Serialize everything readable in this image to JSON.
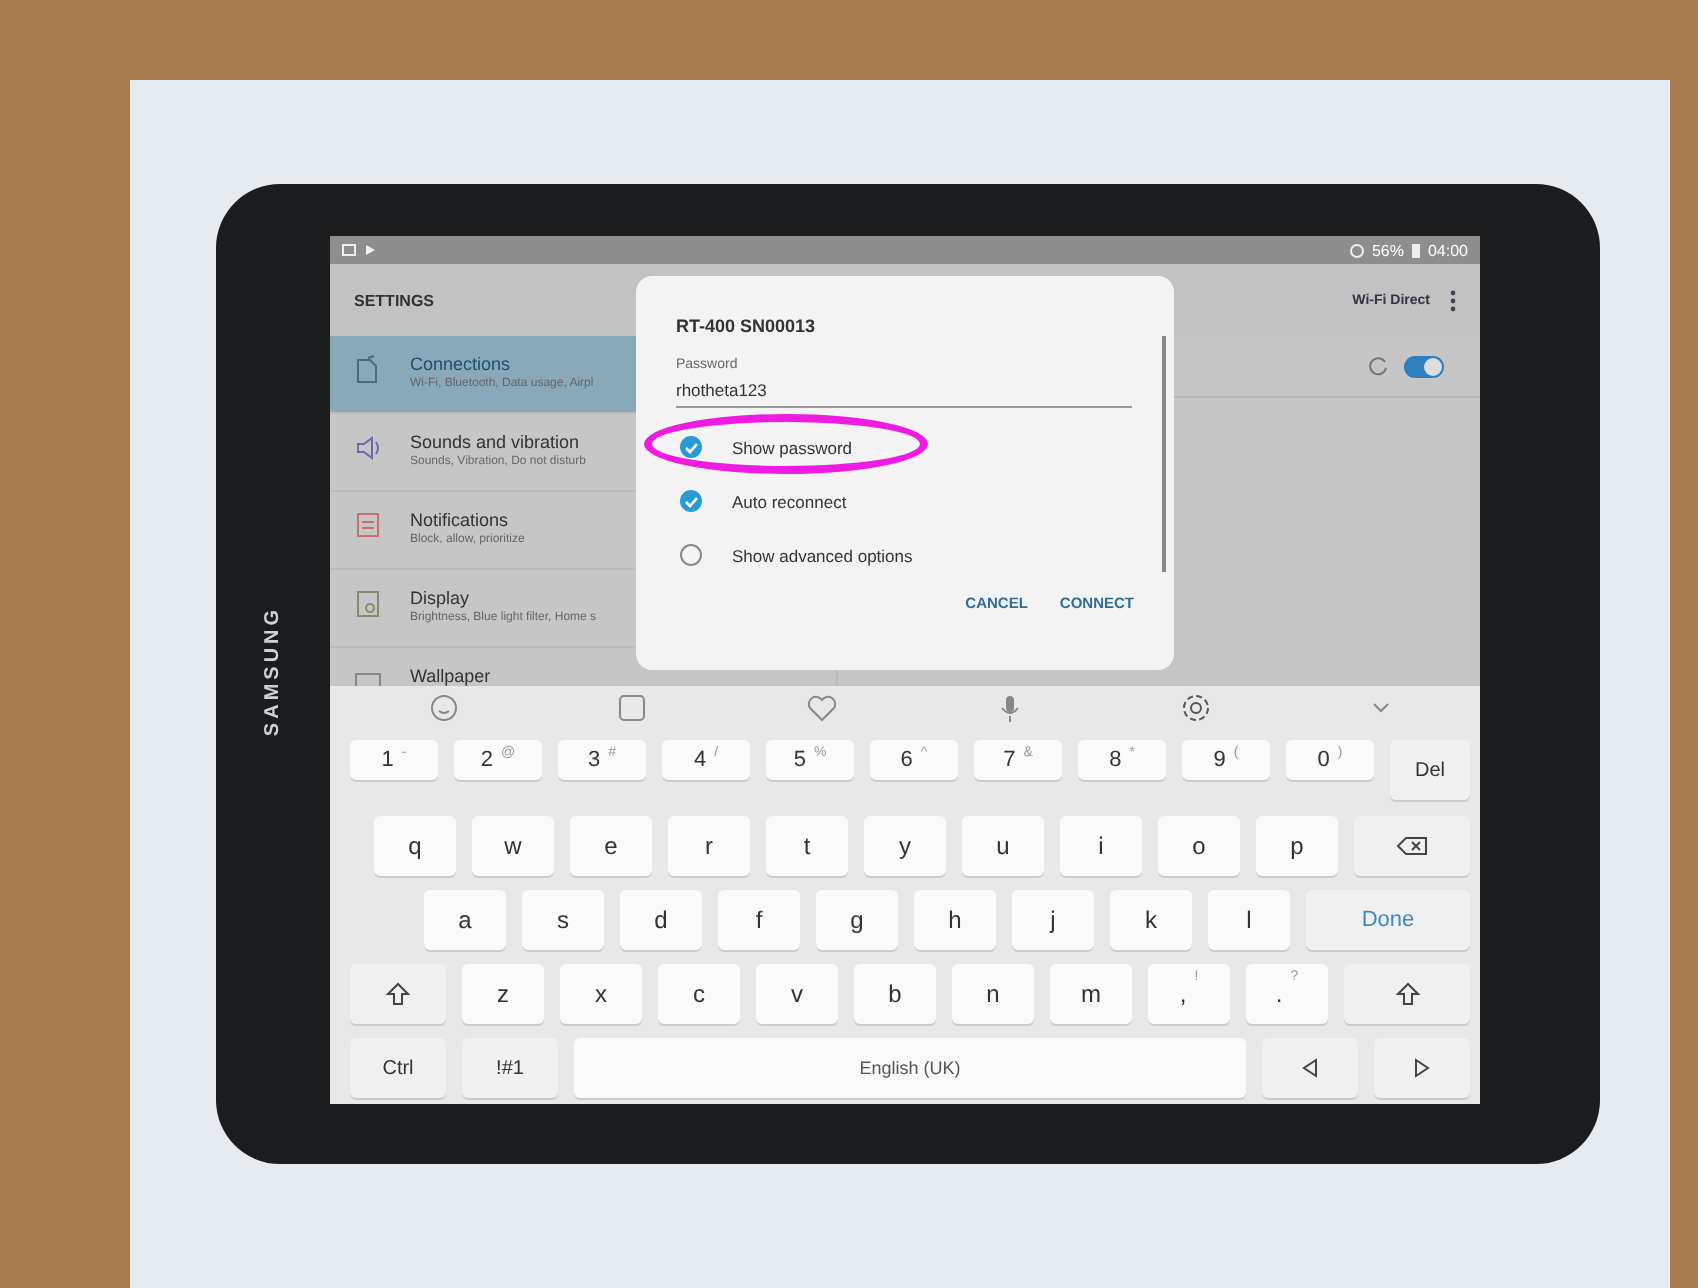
{
  "device": {
    "brand": "SAMSUNG"
  },
  "status_bar": {
    "battery": "56%",
    "time": "04:00"
  },
  "settings": {
    "title": "SETTINGS",
    "action": "Wi-Fi Direct",
    "switch": {
      "on": true
    },
    "items": [
      {
        "title": "Connections",
        "subtitle": "Wi-Fi, Bluetooth, Data usage, Airpl",
        "selected": true
      },
      {
        "title": "Sounds and vibration",
        "subtitle": "Sounds, Vibration, Do not disturb",
        "selected": false
      },
      {
        "title": "Notifications",
        "subtitle": "Block, allow, prioritize",
        "selected": false
      },
      {
        "title": "Display",
        "subtitle": "Brightness, Blue light filter, Home s",
        "selected": false
      },
      {
        "title": "Wallpaper",
        "selected": false
      }
    ]
  },
  "dialog": {
    "title": "RT-400 SN00013",
    "field_label": "Password",
    "password": "rhotheta123",
    "options": [
      {
        "label": "Show password",
        "checked": true,
        "highlighted": true
      },
      {
        "label": "Auto reconnect",
        "checked": true,
        "highlighted": false
      },
      {
        "label": "Show advanced options",
        "checked": false,
        "highlighted": false
      }
    ],
    "buttons": [
      "CANCEL",
      "CONNECT"
    ]
  },
  "keyboard": {
    "rows": [
      {
        "keys": [
          {
            "kind": "num",
            "label": "1",
            "alt": "-"
          },
          {
            "kind": "num",
            "label": "2",
            "alt": "@"
          },
          {
            "kind": "num",
            "label": "3",
            "alt": "#"
          },
          {
            "kind": "num",
            "label": "4",
            "alt": "/"
          },
          {
            "kind": "num",
            "label": "5",
            "alt": "%"
          },
          {
            "kind": "num",
            "label": "6",
            "alt": "^"
          },
          {
            "kind": "num",
            "label": "7",
            "alt": "&"
          },
          {
            "kind": "num",
            "label": "8",
            "alt": "*"
          },
          {
            "kind": "num",
            "label": "9",
            "alt": "("
          },
          {
            "kind": "num",
            "label": "0",
            "alt": ")"
          },
          {
            "kind": "action",
            "label": "Del"
          }
        ]
      },
      {
        "keys": [
          {
            "kind": "char",
            "label": "q"
          },
          {
            "kind": "char",
            "label": "w"
          },
          {
            "kind": "char",
            "label": "e"
          },
          {
            "kind": "char",
            "label": "r"
          },
          {
            "kind": "char",
            "label": "t"
          },
          {
            "kind": "char",
            "label": "y"
          },
          {
            "kind": "char",
            "label": "u"
          },
          {
            "kind": "char",
            "label": "i"
          },
          {
            "kind": "char",
            "label": "o"
          },
          {
            "kind": "char",
            "label": "p"
          },
          {
            "kind": "backspace"
          }
        ]
      },
      {
        "keys": [
          {
            "kind": "char",
            "label": "a"
          },
          {
            "kind": "char",
            "label": "s"
          },
          {
            "kind": "char",
            "label": "d"
          },
          {
            "kind": "char",
            "label": "f"
          },
          {
            "kind": "char",
            "label": "g"
          },
          {
            "kind": "char",
            "label": "h"
          },
          {
            "kind": "char",
            "label": "j"
          },
          {
            "kind": "char",
            "label": "k"
          },
          {
            "kind": "char",
            "label": "l"
          },
          {
            "kind": "enter",
            "label": "Done"
          }
        ]
      },
      {
        "keys": [
          {
            "kind": "shift"
          },
          {
            "kind": "char",
            "label": "z"
          },
          {
            "kind": "char",
            "label": "x"
          },
          {
            "kind": "char",
            "label": "c"
          },
          {
            "kind": "char",
            "label": "v"
          },
          {
            "kind": "char",
            "label": "b"
          },
          {
            "kind": "char",
            "label": "n"
          },
          {
            "kind": "char",
            "label": "m"
          },
          {
            "kind": "char",
            "label": ",",
            "alt": "!"
          },
          {
            "kind": "char",
            "label": ".",
            "alt": "?"
          },
          {
            "kind": "shift"
          }
        ]
      },
      {
        "keys": [
          {
            "kind": "action",
            "label": "Ctrl"
          },
          {
            "kind": "action",
            "label": "!#1"
          },
          {
            "kind": "space",
            "label": "English (UK)"
          },
          {
            "kind": "left"
          },
          {
            "kind": "right"
          }
        ]
      }
    ]
  }
}
